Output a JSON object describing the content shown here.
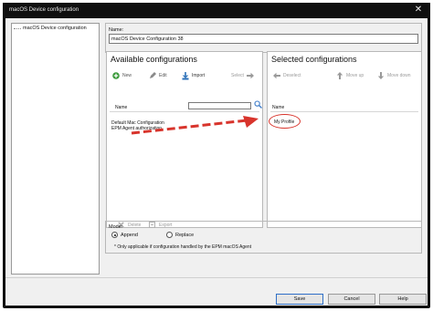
{
  "window": {
    "title": "macOS Device configuration"
  },
  "tree": {
    "items": [
      "macOS Device configuration"
    ]
  },
  "name_field": {
    "label": "Name:",
    "value": "macOS Device Configuration 38"
  },
  "available": {
    "title": "Available configurations",
    "toolbar": {
      "new": "New",
      "edit": "Edit",
      "import": "Import",
      "select": "Select"
    },
    "column_name": "Name",
    "items": [
      "Default Mac Configuration",
      "EPM Agent authorization"
    ],
    "bottom_toolbar": {
      "delete": "Delete",
      "export": "Export"
    }
  },
  "selected": {
    "title": "Selected configurations",
    "toolbar": {
      "deselect": "Deselect",
      "move_up": "Move up",
      "move_down": "Move down"
    },
    "column_name": "Name",
    "items": [
      "My Profile"
    ]
  },
  "mode": {
    "label": "Mode:",
    "options": [
      "Append",
      "Replace"
    ],
    "selected": "Append",
    "note": "* Only applicable if configuration handled by the EPM macOS Agent"
  },
  "buttons": {
    "save": "Save",
    "cancel": "Cancel",
    "help": "Help"
  },
  "colors": {
    "accent": "#2f6fc7",
    "annotation": "#d8342c",
    "new_icon": "#3a9a3a",
    "import_icon": "#2a6fb8"
  }
}
